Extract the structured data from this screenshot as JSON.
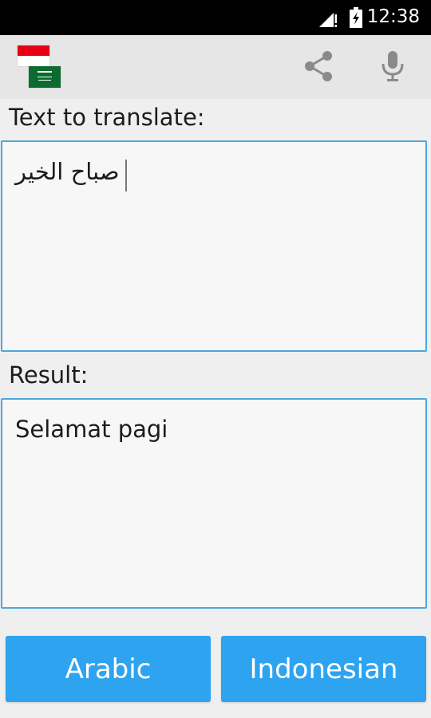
{
  "status_bar": {
    "time": "12:38",
    "icons": [
      "signal-icon",
      "battery-charging-icon"
    ]
  },
  "action_bar": {
    "flags": [
      "indonesia-flag-icon",
      "saudi-arabia-flag-icon"
    ],
    "actions": [
      "share-icon",
      "microphone-icon"
    ]
  },
  "source": {
    "label": "Text to translate:",
    "text": "صباح الخير"
  },
  "result": {
    "label": "Result:",
    "text": "Selamat pagi"
  },
  "buttons": {
    "source_language": "Arabic",
    "target_language": "Indonesian"
  },
  "colors": {
    "accent": "#2ea3ef",
    "field_border": "#4fa6dc",
    "action_bar": "#e6e6e6",
    "background": "#efefef"
  }
}
